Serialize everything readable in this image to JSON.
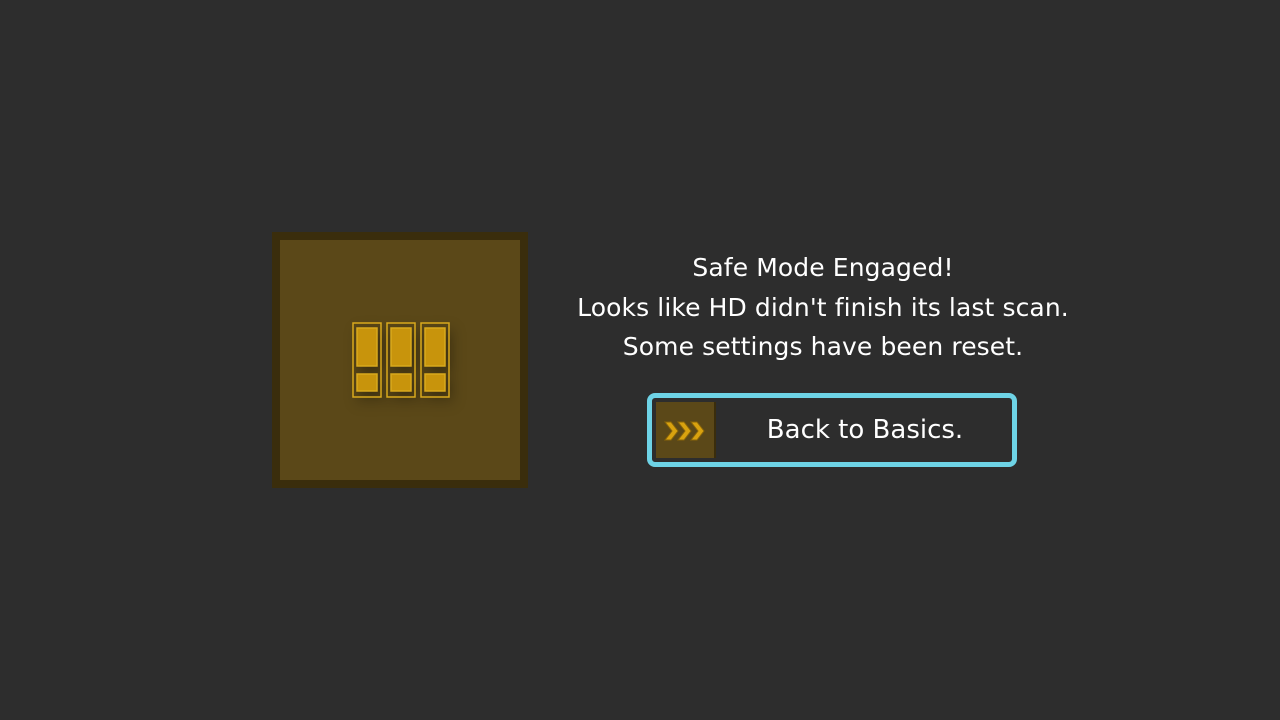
{
  "dialog": {
    "title_line": "Safe Mode Engaged!",
    "message_line_1": "Looks like HD didn't finish its last scan.",
    "message_line_2": "Some settings have been reset.",
    "icon": "triple-exclamation-warning-icon"
  },
  "action_button": {
    "label": "Back to Basics.",
    "icon": "triple-chevron-right-icon"
  },
  "colors": {
    "background": "#2d2d2d",
    "tile_fill": "#5b4818",
    "tile_border": "#3a2d0c",
    "accent_gold": "#c8940c",
    "focus_outline": "#6ed3e6",
    "text": "#ffffff"
  }
}
